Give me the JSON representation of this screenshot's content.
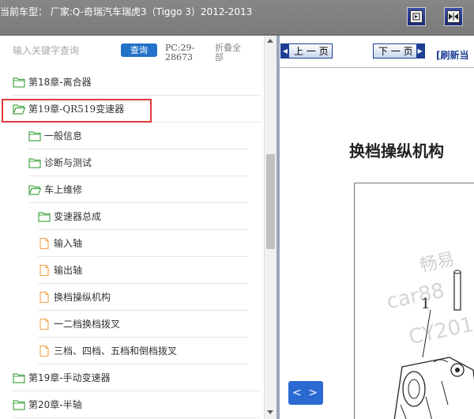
{
  "window": {
    "title": "当前车型： 厂家:Q-奇瑞汽车瑞虎3（Tiggo 3）2012-2013"
  },
  "toolbar": {
    "buttons": [
      {
        "name": "expand-panel-icon"
      },
      {
        "name": "split-view-icon"
      }
    ]
  },
  "sidebar": {
    "search_placeholder": "输入关键字查询",
    "search_button": "查询",
    "pc_code": "PC:29-28673",
    "collapse_all": "折叠全部",
    "tree": [
      {
        "label": "第18章-离合器",
        "icon": "folder-icon",
        "level": 0,
        "serif": false
      },
      {
        "label": "第19章-QR519变速器",
        "icon": "folder-open-icon",
        "level": 0,
        "serif": true,
        "highlighted": true
      },
      {
        "label": "一般信息",
        "icon": "folder-icon",
        "level": 1,
        "serif": false
      },
      {
        "label": "诊断与测试",
        "icon": "folder-icon",
        "level": 1,
        "serif": false
      },
      {
        "label": "车上维修",
        "icon": "folder-open-icon",
        "level": 1,
        "serif": false
      },
      {
        "label": "变速器总成",
        "icon": "folder-icon",
        "level": 2,
        "serif": false
      },
      {
        "label": "输入轴",
        "icon": "document-icon",
        "level": 2,
        "serif": false
      },
      {
        "label": "输出轴",
        "icon": "document-icon",
        "level": 2,
        "serif": false
      },
      {
        "label": "换档操纵机构",
        "icon": "document-icon",
        "level": 2,
        "serif": false
      },
      {
        "label": "一二档换档拨叉",
        "icon": "document-icon",
        "level": 2,
        "serif": false
      },
      {
        "label": "三档、四档、五档和倒档拨叉",
        "icon": "document-icon",
        "level": 2,
        "serif": false
      },
      {
        "label": "第19章-手动变速器",
        "icon": "folder-icon",
        "level": 0,
        "serif": false
      },
      {
        "label": "第20章-半轴",
        "icon": "folder-icon",
        "level": 0,
        "serif": false
      }
    ]
  },
  "viewer": {
    "prev_label": "上 一 页",
    "next_label": "下 一 页",
    "refresh_label": "[刷新当",
    "doc_title": "换档操纵机构",
    "callout": "1",
    "watermark": [
      "畅易",
      "car88",
      "CY201"
    ],
    "toggle_label": "< >"
  },
  "colors": {
    "titlebar": "#808080",
    "folder": "#4aa84a",
    "document": "#f0a24a",
    "highlight": "#e03a3a",
    "accent": "#2272c9"
  }
}
